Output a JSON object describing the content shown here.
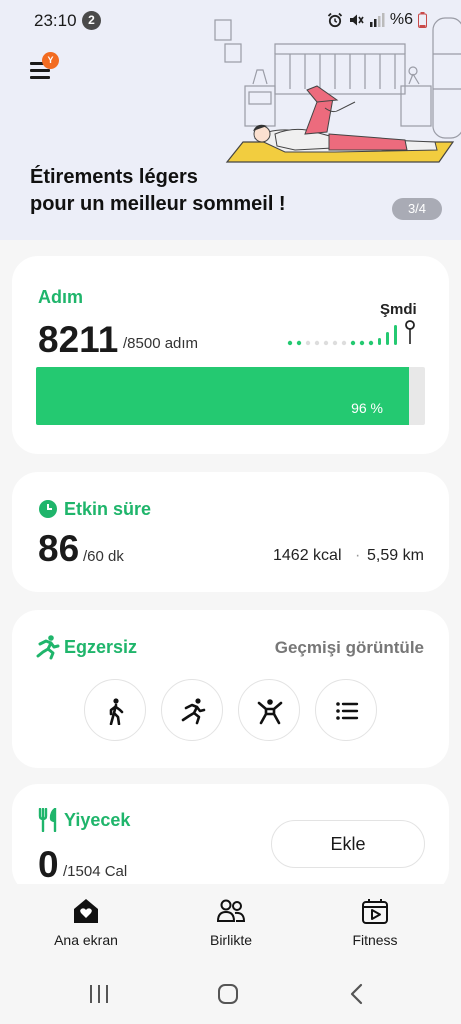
{
  "status_bar": {
    "time": "23:10",
    "notification_count": "2",
    "battery": "%6"
  },
  "banner": {
    "menu_badge": "Y",
    "title_line1": "Étirements légers",
    "title_line2": "pour un meilleur sommeil !",
    "page_indicator": "3/4"
  },
  "steps": {
    "title": "Adım",
    "value": "8211",
    "goal": "/8500 adım",
    "now_label": "Şmdi",
    "progress_text": "96 %",
    "progress_fraction": 0.96,
    "accent_color": "#24c971"
  },
  "active_time": {
    "title": "Etkin süre",
    "value": "86",
    "goal": "/60 dk",
    "kcal": "1462 kcal",
    "separator": "·",
    "distance": "5,59 km"
  },
  "exercise": {
    "title": "Egzersiz",
    "history_link": "Geçmişi görüntüle",
    "buttons": [
      "walking-icon",
      "running-icon",
      "workout-icon",
      "list-icon"
    ]
  },
  "food": {
    "title": "Yiyecek",
    "value": "0",
    "goal": "/1504 Cal",
    "add_label": "Ekle"
  },
  "bottom_nav": {
    "items": [
      {
        "label": "Ana ekran",
        "icon": "home-heart-icon"
      },
      {
        "label": "Birlikte",
        "icon": "people-icon"
      },
      {
        "label": "Fitness",
        "icon": "fitness-play-icon"
      }
    ]
  }
}
